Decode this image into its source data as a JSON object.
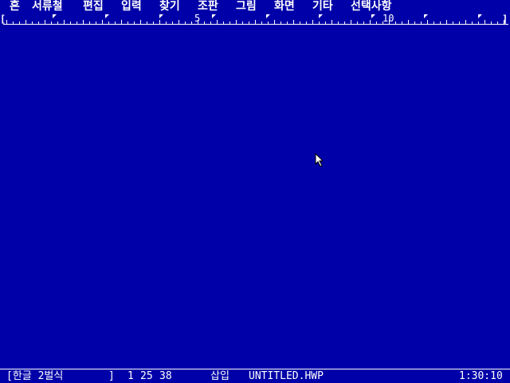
{
  "menubar": {
    "items": [
      {
        "label": "흔"
      },
      {
        "label": "서류철"
      },
      {
        "label": "편집"
      },
      {
        "label": "입력"
      },
      {
        "label": "찾기"
      },
      {
        "label": "조판"
      },
      {
        "label": "그림"
      },
      {
        "label": "화면"
      },
      {
        "label": "기타"
      },
      {
        "label": "선택사항"
      }
    ]
  },
  "ruler": {
    "left_bracket": "[",
    "right_bracket": "]",
    "numbers": [
      "5",
      "10"
    ]
  },
  "status": {
    "mode_left": "[한글 2벌식",
    "mode_right": "]",
    "line": "1",
    "column": "25",
    "position": "38",
    "insert_mode": "삽입",
    "filename": "UNTITLED.HWP",
    "time": "1:30:10"
  },
  "colors": {
    "background": "#0000a8",
    "foreground": "#ffffff"
  }
}
